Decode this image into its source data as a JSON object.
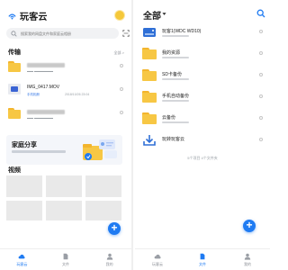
{
  "left": {
    "app_title": "玩客云",
    "search": {
      "placeholder": "搜索我的网盘文件和家庭云相册"
    },
    "transfer_section": {
      "title": "传输",
      "more": "全部 >"
    },
    "files": [
      {
        "type": "folder",
        "name": "",
        "tag": "",
        "date": ""
      },
      {
        "type": "video",
        "name": "IMG_0417.MOV",
        "tag": "手机相册",
        "date": "2018/10/26 23:04"
      },
      {
        "type": "folder",
        "name": "",
        "tag": "",
        "date": ""
      }
    ],
    "family_share": {
      "title": "家庭分享"
    },
    "video_section": {
      "title": "视频"
    },
    "fab_label": "+",
    "tabs": [
      {
        "label": "玩客云",
        "icon": "cloud-icon",
        "active": true
      },
      {
        "label": "文件",
        "icon": "file-icon",
        "active": false
      },
      {
        "label": "我的",
        "icon": "user-icon",
        "active": false
      }
    ]
  },
  "right": {
    "header_title": "全部",
    "items": [
      {
        "type": "drive",
        "name": "玩客1(WDC WD10)"
      },
      {
        "type": "folder",
        "name": "我的资源"
      },
      {
        "type": "folder",
        "name": "SD卡备份"
      },
      {
        "type": "folder",
        "name": "手机自动备份"
      },
      {
        "type": "folder",
        "name": "云备份"
      },
      {
        "type": "special",
        "name": "玩转玩客云"
      }
    ],
    "footer": "5个项目 4个文件夹",
    "fab_label": "+",
    "tabs": [
      {
        "label": "玩客云",
        "icon": "cloud-icon",
        "active": false
      },
      {
        "label": "文件",
        "icon": "file-icon",
        "active": true
      },
      {
        "label": "我的",
        "icon": "user-icon",
        "active": false
      }
    ]
  },
  "colors": {
    "accent": "#1f7bf2",
    "folder": "#f7c744",
    "avatar": "#f5c83a"
  }
}
